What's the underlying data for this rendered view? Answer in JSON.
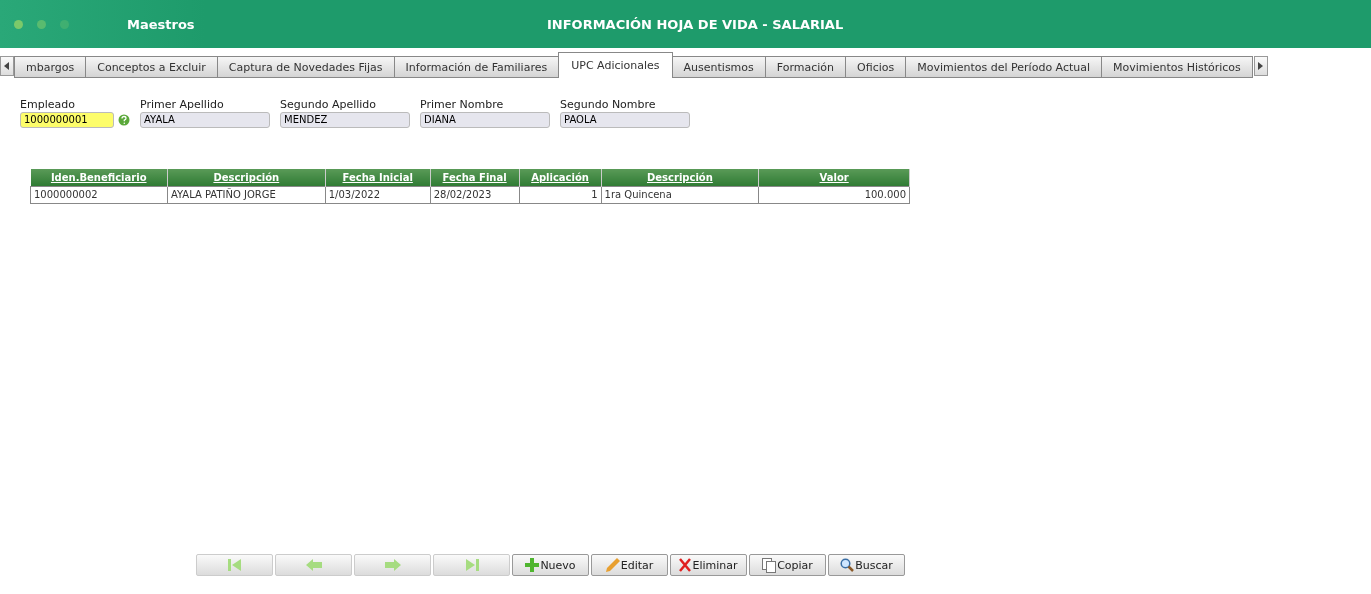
{
  "header": {
    "module": "Maestros",
    "title": "INFORMACIÓN HOJA DE VIDA - SALARIAL"
  },
  "tabs": [
    {
      "label": "mbargos",
      "selected": false
    },
    {
      "label": "Conceptos a Excluir",
      "selected": false
    },
    {
      "label": "Captura de Novedades Fijas",
      "selected": false
    },
    {
      "label": "Información de Familiares",
      "selected": false
    },
    {
      "label": "UPC Adicionales",
      "selected": true
    },
    {
      "label": "Ausentismos",
      "selected": false
    },
    {
      "label": "Formación",
      "selected": false
    },
    {
      "label": "Oficios",
      "selected": false
    },
    {
      "label": "Movimientos del Período Actual",
      "selected": false
    },
    {
      "label": "Movimientos Históricos",
      "selected": false
    }
  ],
  "fields": [
    {
      "label": "Empleado",
      "value": "1000000001",
      "kind": "key"
    },
    {
      "label": "Primer Apellido",
      "value": "AYALA",
      "kind": "readonly"
    },
    {
      "label": "Segundo Apellido",
      "value": "MENDEZ",
      "kind": "readonly"
    },
    {
      "label": "Primer Nombre",
      "value": "DIANA",
      "kind": "readonly"
    },
    {
      "label": "Segundo Nombre",
      "value": "PAOLA",
      "kind": "readonly"
    }
  ],
  "table": {
    "columns": [
      "Iden.Beneficiario",
      "Descripción",
      "Fecha Inicial",
      "Fecha Final",
      "Aplicación",
      "Descripción",
      "Valor"
    ],
    "rows": [
      [
        "1000000002",
        "AYALA PATIÑO JORGE",
        "1/03/2022",
        "28/02/2023",
        "1",
        "1ra Quincena",
        "100.000"
      ]
    ]
  },
  "buttons": [
    {
      "kind": "first",
      "disabled": true
    },
    {
      "kind": "prev",
      "disabled": true
    },
    {
      "kind": "next",
      "disabled": true
    },
    {
      "kind": "last",
      "disabled": true
    },
    {
      "kind": "new",
      "label": "Nuevo",
      "disabled": false
    },
    {
      "kind": "edit",
      "label": "Editar",
      "disabled": false
    },
    {
      "kind": "delete",
      "label": "Eliminar",
      "disabled": false
    },
    {
      "kind": "copy",
      "label": "Copiar",
      "disabled": false
    },
    {
      "kind": "search",
      "label": "Buscar",
      "disabled": false
    }
  ]
}
